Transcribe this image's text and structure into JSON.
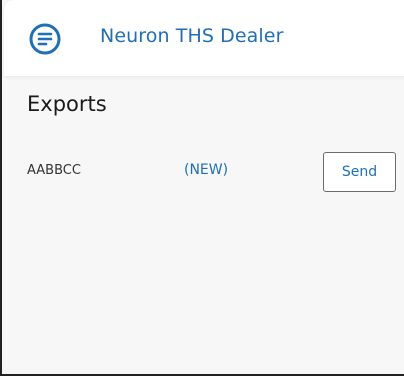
{
  "header": {
    "logo_icon": "menu-lines-circle-icon",
    "title": "Neuron THS Dealer",
    "accent_color": "#1f6fb6"
  },
  "page": {
    "title": "Exports"
  },
  "exports": [
    {
      "name": "AABBCC",
      "status": "(NEW)",
      "action_label": "Send"
    }
  ]
}
